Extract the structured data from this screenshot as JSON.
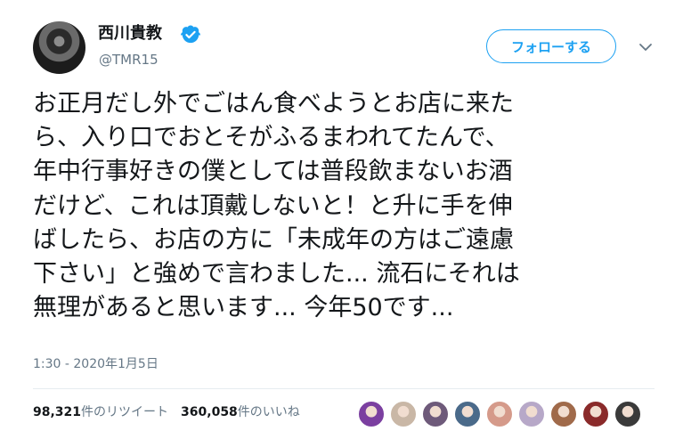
{
  "user": {
    "display_name": "西川貴教",
    "handle": "@TMR15",
    "verified": true
  },
  "follow_button": {
    "label": "フォローする"
  },
  "tweet": {
    "lines": [
      "お正月だし外でごはん食べようとお店に来た",
      "ら、入り口でおとそがふるまわれてたんで、",
      "年中行事好きの僕としては普段飲まないお酒",
      "だけど、これは頂戴しないと！と升に手を伸",
      "ばしたら、お店の方に「未成年の方はご遠慮",
      "下さい」と強めで言わました... 流石にそれは",
      "無理があると思います... 今年50です..."
    ],
    "timestamp": "1:30 - 2020年1月5日"
  },
  "stats": {
    "retweets_count": "98,321",
    "retweets_label": "件のリツイート",
    "likes_count": "360,058",
    "likes_label": "件のいいね"
  },
  "colors": {
    "accent": "#1da1f2",
    "text": "#14171a",
    "secondary": "#657786",
    "divider": "#e6ecf0"
  },
  "icons": {
    "verified": "verified-badge-icon",
    "caret": "chevron-down-icon"
  },
  "liker_avatars": [
    {
      "color": "#7b3fa0"
    },
    {
      "color": "#c9b7a6"
    },
    {
      "color": "#6e5a7a"
    },
    {
      "color": "#4a6a8a"
    },
    {
      "color": "#d59a8a"
    },
    {
      "color": "#b7a8c8"
    },
    {
      "color": "#a06a4a"
    },
    {
      "color": "#8a2a2a"
    },
    {
      "color": "#3a3a3a"
    }
  ]
}
